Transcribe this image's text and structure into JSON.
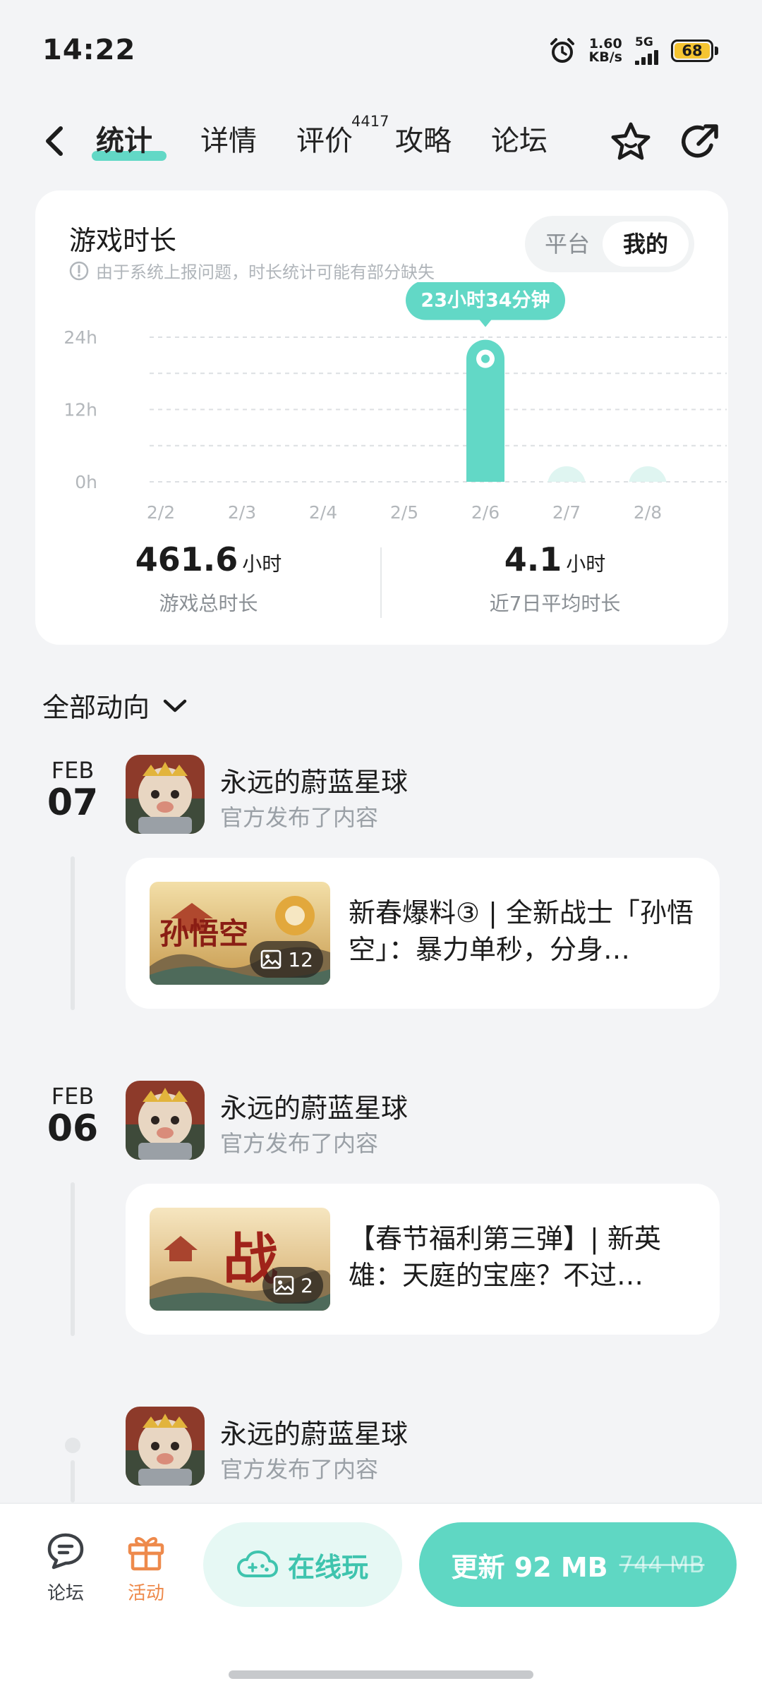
{
  "status_bar": {
    "time": "14:22",
    "net_speed_value": "1.60",
    "net_speed_unit": "KB/s",
    "network": "5G",
    "battery": "68"
  },
  "nav": {
    "tabs": [
      {
        "label": "统计",
        "active": true
      },
      {
        "label": "详情",
        "active": false
      },
      {
        "label": "评价",
        "active": false,
        "badge": "4417"
      },
      {
        "label": "攻略",
        "active": false
      },
      {
        "label": "论坛",
        "active": false
      }
    ]
  },
  "stats": {
    "title": "游戏时长",
    "note": "由于系统上报问题，时长统计可能有部分缺失",
    "segment": {
      "options": [
        "平台",
        "我的"
      ],
      "selected": "我的"
    },
    "tooltip": "23小时34分钟",
    "summary": [
      {
        "value": "461.6",
        "unit": "小时",
        "label": "游戏总时长"
      },
      {
        "value": "4.1",
        "unit": "小时",
        "label": "近7日平均时长"
      }
    ]
  },
  "chart_data": {
    "type": "bar",
    "categories": [
      "2/2",
      "2/3",
      "2/4",
      "2/5",
      "2/6",
      "2/7",
      "2/8"
    ],
    "values": [
      0,
      0,
      0,
      0,
      23.57,
      0.3,
      0.3
    ],
    "unit": "h",
    "y_ticks": [
      "24h",
      "12h",
      "0h"
    ],
    "ylim": [
      0,
      24
    ],
    "grid": true,
    "highlight_index": 4,
    "color": "#62d8c6",
    "faint_color": "#dff5f1"
  },
  "feed": {
    "filter_label": "全部动向",
    "items": [
      {
        "month": "FEB",
        "day": "07",
        "game": "永远的蔚蓝星球",
        "action": "官方发布了内容",
        "post": "新春爆料③ | 全新战士「孙悟空」：暴力单秒，分身…",
        "thumb_text": "孙悟空",
        "image_count": "12"
      },
      {
        "month": "FEB",
        "day": "06",
        "game": "永远的蔚蓝星球",
        "action": "官方发布了内容",
        "post": "【春节福利第三弹】| 新英雄：天庭的宝座？不过…",
        "thumb_text": "战",
        "image_count": "2"
      },
      {
        "game": "永远的蔚蓝星球",
        "action": "官方发布了内容"
      }
    ]
  },
  "bottom_bar": {
    "forum_label": "论坛",
    "activity_label": "活动",
    "play_label": "在线玩",
    "update_label": "更新 92 MB",
    "update_old_size": "744 MB"
  },
  "colors": {
    "accent": "#62d8c6",
    "activity": "#ee8a4c",
    "background": "#f3f4f6"
  }
}
